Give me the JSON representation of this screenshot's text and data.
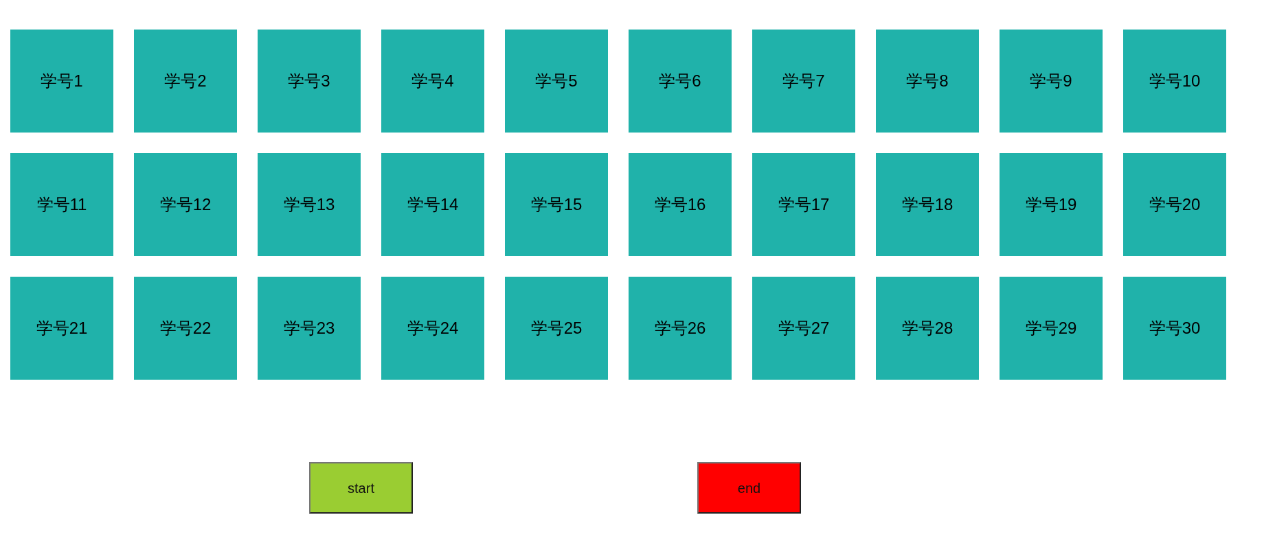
{
  "students": [
    "学号1",
    "学号2",
    "学号3",
    "学号4",
    "学号5",
    "学号6",
    "学号7",
    "学号8",
    "学号9",
    "学号10",
    "学号11",
    "学号12",
    "学号13",
    "学号14",
    "学号15",
    "学号16",
    "学号17",
    "学号18",
    "学号19",
    "学号20",
    "学号21",
    "学号22",
    "学号23",
    "学号24",
    "学号25",
    "学号26",
    "学号27",
    "学号28",
    "学号29",
    "学号30"
  ],
  "buttons": [
    {
      "label": "start",
      "color": "#9acd32"
    },
    {
      "label": "end",
      "color": "#ff0000"
    }
  ]
}
